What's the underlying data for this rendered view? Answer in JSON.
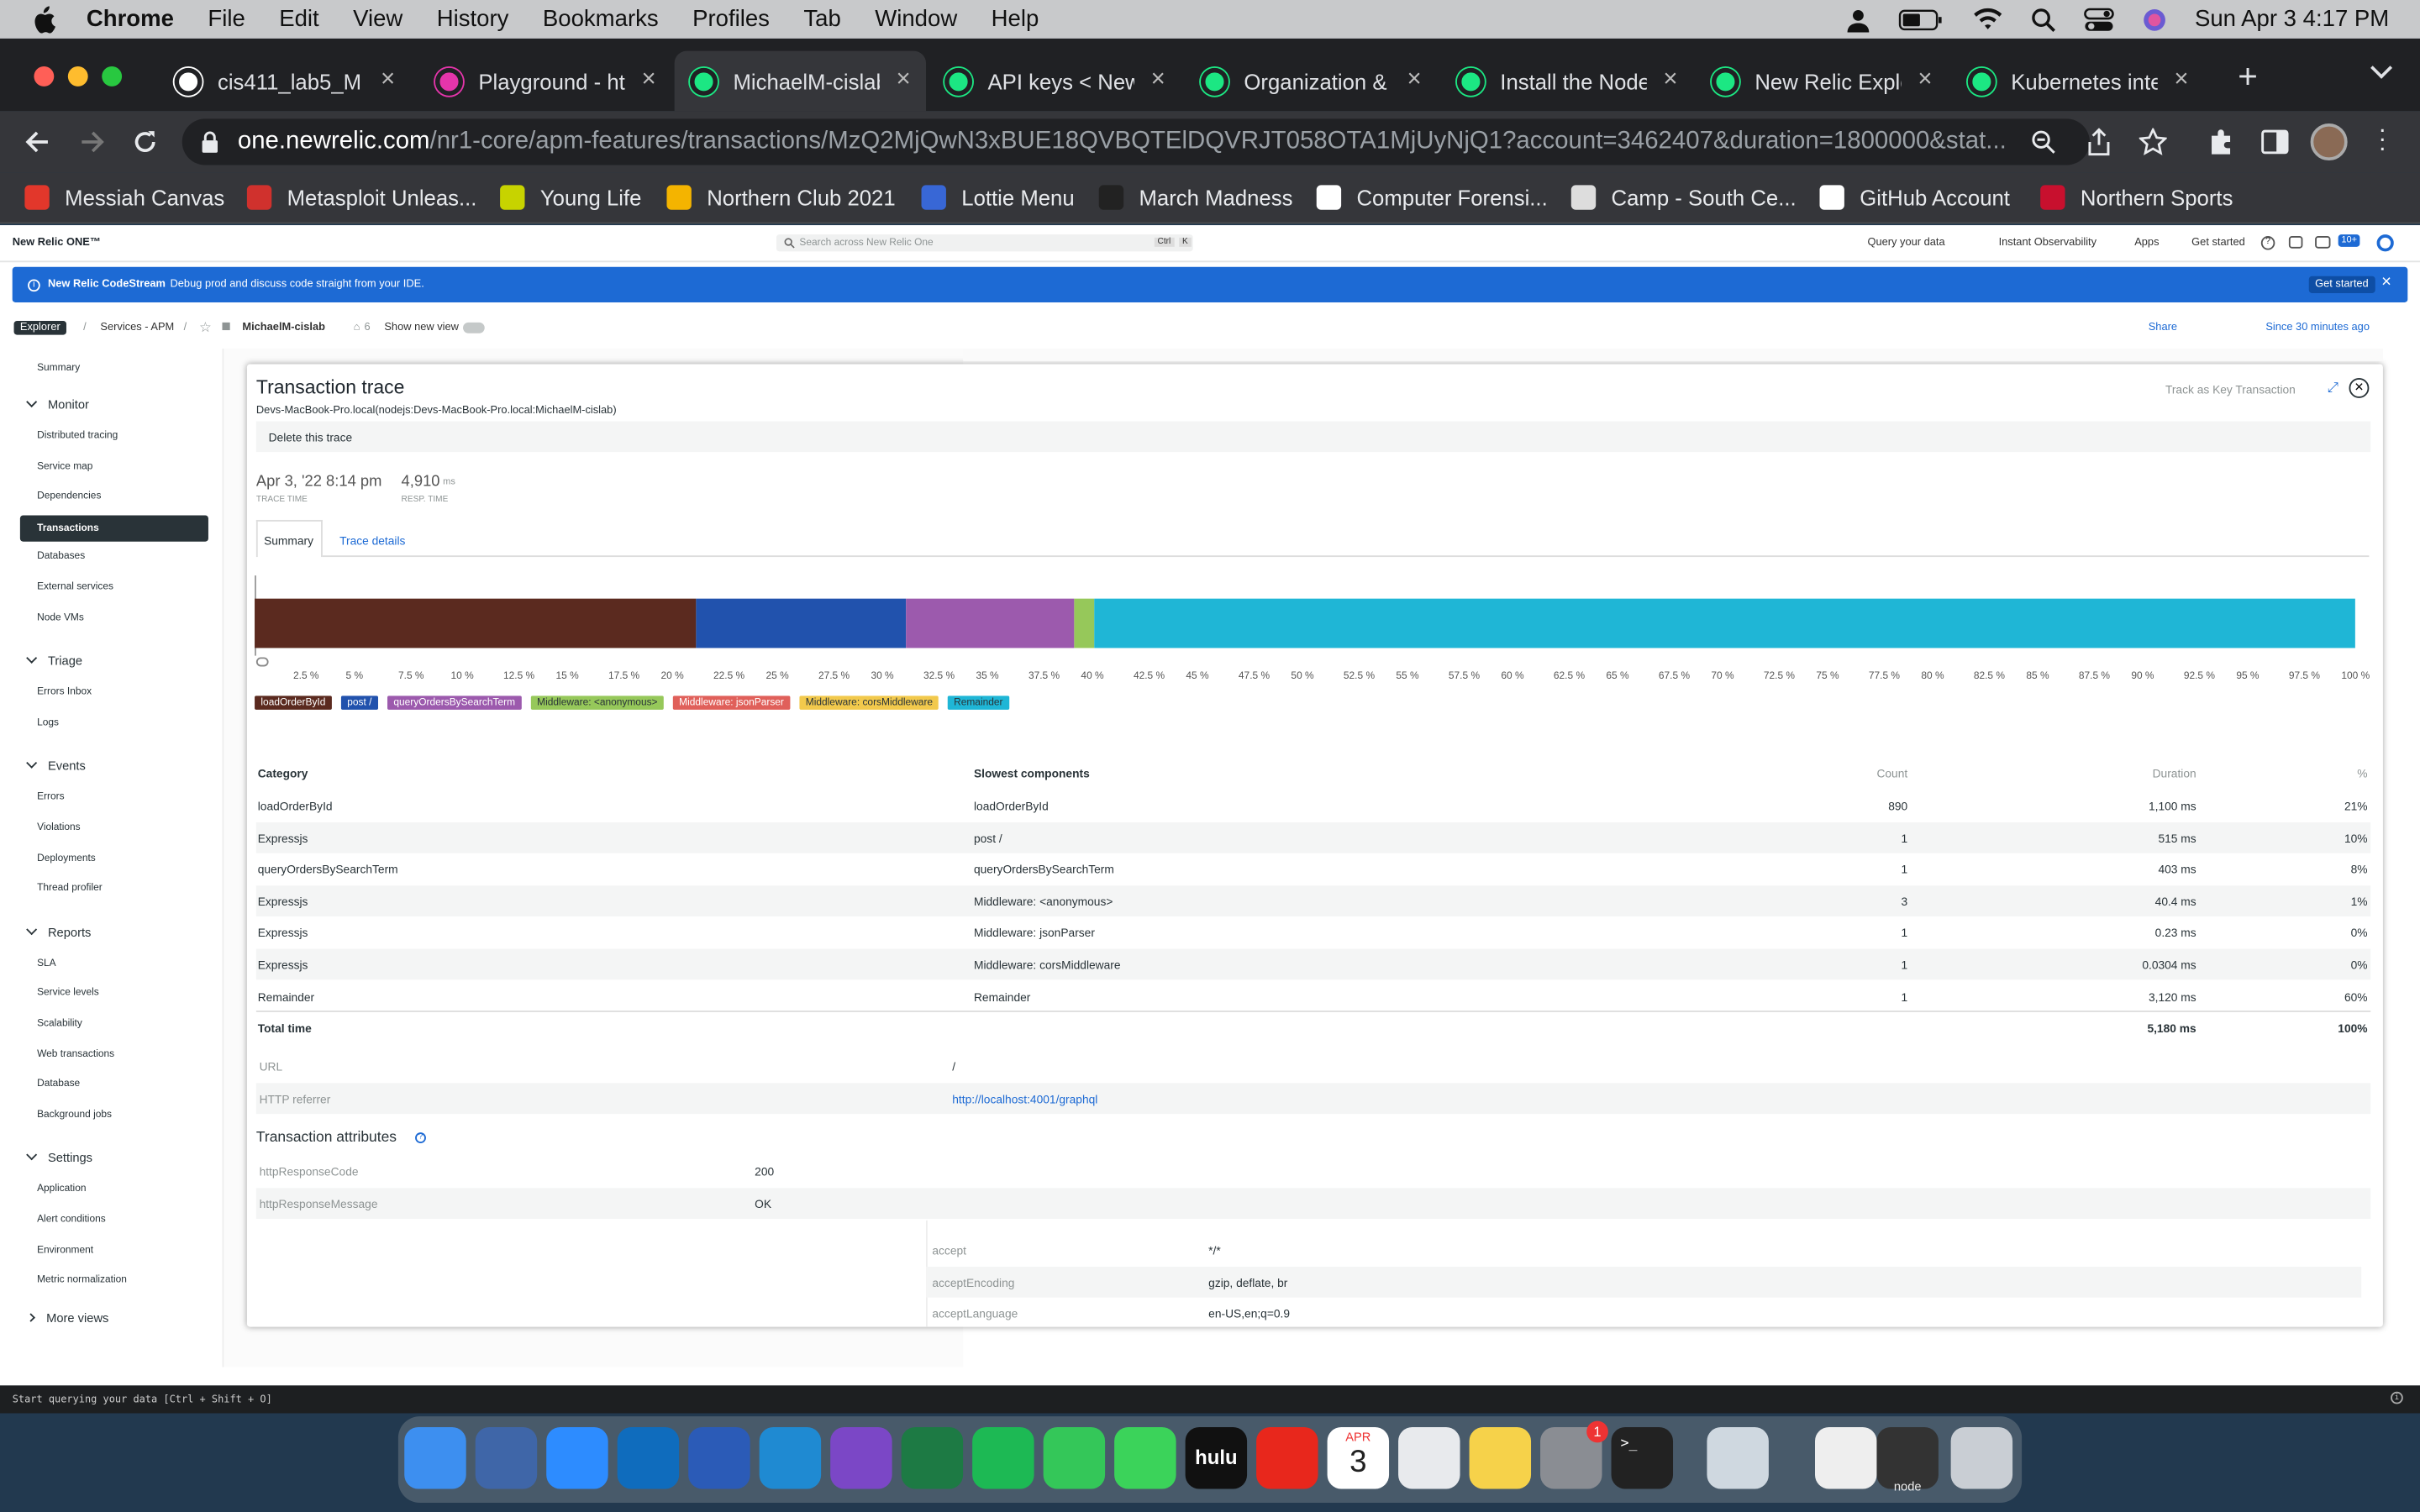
{
  "menubar": {
    "app": "Chrome",
    "items": [
      "File",
      "Edit",
      "View",
      "History",
      "Bookmarks",
      "Profiles",
      "Tab",
      "Window",
      "Help"
    ],
    "clock": "Sun Apr 3  4:17 PM"
  },
  "tabs": [
    {
      "label": "cis411_lab5_M",
      "color": "#ffffff"
    },
    {
      "label": "Playground - ht",
      "color": "#e535ab"
    },
    {
      "label": "MichaelM-cislab",
      "color": "#1ce783"
    },
    {
      "label": "API keys < New",
      "color": "#1ce783"
    },
    {
      "label": "Organization &",
      "color": "#1ce783"
    },
    {
      "label": "Install the Node",
      "color": "#1ce783"
    },
    {
      "label": "New Relic Explo",
      "color": "#1ce783"
    },
    {
      "label": "Kubernetes inte",
      "color": "#1ce783"
    }
  ],
  "url": {
    "host": "one.newrelic.com",
    "path": "/nr1-core/apm-features/transactions/MzQ2MjQwN3xBUE18QVBQTElDQVRJT058OTA1MjUyNjQ1?account=3462407&duration=1800000&stat..."
  },
  "bookmarks": [
    {
      "label": "Messiah Canvas",
      "color": "#e2372b"
    },
    {
      "label": "Metasploit Unleas...",
      "color": "#d0312d"
    },
    {
      "label": "Young Life",
      "color": "#c7d300"
    },
    {
      "label": "Northern Club 2021",
      "color": "#f4b400"
    },
    {
      "label": "Lottie Menu",
      "color": "#3867d6"
    },
    {
      "label": "March Madness",
      "color": "#222222"
    },
    {
      "label": "Computer Forensi...",
      "color": "#ffffff"
    },
    {
      "label": "Camp - South Ce...",
      "color": "#dddddd"
    },
    {
      "label": "GitHub Account",
      "color": "#ffffff"
    },
    {
      "label": "Northern Sports",
      "color": "#c8102e"
    }
  ],
  "nr": {
    "logo": "New Relic ONE™",
    "search_placeholder": "Search across New Relic One",
    "search_key1": "Ctrl",
    "search_key2": "K",
    "top_links": [
      "Query your data",
      "Instant Observability",
      "Apps",
      "Get started"
    ],
    "badge": "10+",
    "banner_title": "New Relic CodeStream",
    "banner_text": "Debug prod and discuss code straight from your IDE.",
    "banner_button": "Get started",
    "crumb": {
      "explorer": "Explorer",
      "services": "Services - APM",
      "entity": "MichaelM-cislab",
      "tags": "6",
      "new_view": "Show new view",
      "share": "Share",
      "time": "Since 30 minutes ago"
    }
  },
  "sidebar": {
    "top": "Summary",
    "sections": [
      {
        "title": "Monitor",
        "items": [
          "Distributed tracing",
          "Service map",
          "Dependencies",
          "Transactions",
          "Databases",
          "External services",
          "Node VMs"
        ]
      },
      {
        "title": "Triage",
        "items": [
          "Errors Inbox",
          "Logs"
        ]
      },
      {
        "title": "Events",
        "items": [
          "Errors",
          "Violations",
          "Deployments",
          "Thread profiler"
        ]
      },
      {
        "title": "Reports",
        "items": [
          "SLA",
          "Service levels",
          "Scalability",
          "Web transactions",
          "Database",
          "Background jobs"
        ]
      },
      {
        "title": "Settings",
        "items": [
          "Application",
          "Alert conditions",
          "Environment",
          "Metric normalization"
        ]
      }
    ],
    "more": "More views",
    "selected": "Transactions"
  },
  "trace": {
    "title": "Transaction trace",
    "host": "Devs-MacBook-Pro.local(nodejs:Devs-MacBook-Pro.local:MichaelM-cislab)",
    "key_tx": "Track as Key Transaction",
    "delete": "Delete this trace",
    "trace_time": "Apr 3, '22 8:14 pm",
    "trace_time_label": "TRACE TIME",
    "resp_time": "4,910",
    "resp_unit": "ms",
    "resp_label": "RESP. TIME",
    "tab_summary": "Summary",
    "tab_details": "Trace details"
  },
  "chart_data": {
    "type": "bar",
    "orientation": "horizontal-stacked",
    "xlim": [
      0,
      100
    ],
    "ticks": [
      "2.5 %",
      "5 %",
      "7.5 %",
      "10 %",
      "12.5 %",
      "15 %",
      "17.5 %",
      "20 %",
      "22.5 %",
      "25 %",
      "27.5 %",
      "30 %",
      "32.5 %",
      "35 %",
      "37.5 %",
      "40 %",
      "42.5 %",
      "45 %",
      "47.5 %",
      "50 %",
      "52.5 %",
      "55 %",
      "57.5 %",
      "60 %",
      "62.5 %",
      "65 %",
      "67.5 %",
      "70 %",
      "72.5 %",
      "75 %",
      "77.5 %",
      "80 %",
      "82.5 %",
      "85 %",
      "87.5 %",
      "90 %",
      "92.5 %",
      "95 %",
      "97.5 %",
      "100 %"
    ],
    "segments": [
      {
        "name": "loadOrderById",
        "value": 21,
        "color": "#5b2a1f"
      },
      {
        "name": "post /",
        "value": 10,
        "color": "#2152ad"
      },
      {
        "name": "queryOrdersBySearchTerm",
        "value": 8,
        "color": "#9c5aad"
      },
      {
        "name": "Middleware: <anonymous>",
        "value": 1,
        "color": "#96c85a"
      },
      {
        "name": "Middleware: jsonParser",
        "value": 0,
        "color": "#e0605a"
      },
      {
        "name": "Middleware: corsMiddleware",
        "value": 0,
        "color": "#f2c94c"
      },
      {
        "name": "Remainder",
        "value": 60,
        "color": "#1fb6d6"
      }
    ],
    "legend": [
      {
        "label": "loadOrderById",
        "color": "#5b2a1f",
        "text": "#ffffff"
      },
      {
        "label": "post /",
        "color": "#2152ad",
        "text": "#ffffff"
      },
      {
        "label": "queryOrdersBySearchTerm",
        "color": "#9c5aad",
        "text": "#ffffff"
      },
      {
        "label": "Middleware: <anonymous>",
        "color": "#96c85a",
        "text": "#293338"
      },
      {
        "label": "Middleware: jsonParser",
        "color": "#e0605a",
        "text": "#ffffff"
      },
      {
        "label": "Middleware: corsMiddleware",
        "color": "#f2c94c",
        "text": "#293338"
      },
      {
        "label": "Remainder",
        "color": "#1fb6d6",
        "text": "#293338"
      }
    ]
  },
  "table": {
    "headers": [
      "Category",
      "Slowest components",
      "Count",
      "Duration",
      "%"
    ],
    "rows": [
      [
        "loadOrderById",
        "loadOrderById",
        "890",
        "1,100 ms",
        "21%"
      ],
      [
        "Expressjs",
        "post /",
        "1",
        "515 ms",
        "10%"
      ],
      [
        "queryOrdersBySearchTerm",
        "queryOrdersBySearchTerm",
        "1",
        "403 ms",
        "8%"
      ],
      [
        "Expressjs",
        "Middleware: <anonymous>",
        "3",
        "40.4 ms",
        "1%"
      ],
      [
        "Expressjs",
        "Middleware: jsonParser",
        "1",
        "0.23 ms",
        "0%"
      ],
      [
        "Expressjs",
        "Middleware: corsMiddleware",
        "1",
        "0.0304 ms",
        "0%"
      ],
      [
        "Remainder",
        "Remainder",
        "1",
        "3,120 ms",
        "60%"
      ]
    ],
    "total": [
      "Total time",
      "5,180 ms",
      "100%"
    ]
  },
  "request": {
    "url_label": "URL",
    "url_value": "/",
    "referrer_label": "HTTP referrer",
    "referrer_value": "http://localhost:4001/graphql"
  },
  "attributes": {
    "title": "Transaction attributes",
    "rows": [
      [
        "httpResponseCode",
        "200"
      ],
      [
        "httpResponseMessage",
        "OK"
      ]
    ],
    "headers": [
      [
        "accept",
        "*/*"
      ],
      [
        "acceptEncoding",
        "gzip, deflate, br"
      ],
      [
        "acceptLanguage",
        "en-US,en;q=0.9"
      ]
    ]
  },
  "statusbar": "Start querying your data [Ctrl + Shift + O]",
  "dock": [
    {
      "name": "finder-icon",
      "color": "#3d8ff0"
    },
    {
      "name": "virtualbox-icon",
      "color": "#3f66a8"
    },
    {
      "name": "zoom-icon",
      "color": "#2d8cff"
    },
    {
      "name": "outlook-icon",
      "color": "#0f6cbd"
    },
    {
      "name": "word-icon",
      "color": "#2b5bb7"
    },
    {
      "name": "vscode-icon",
      "color": "#1f8ad2"
    },
    {
      "name": "github-desktop-icon",
      "color": "#7b47c6"
    },
    {
      "name": "excel-icon",
      "color": "#1d7a44"
    },
    {
      "name": "spotify-icon",
      "color": "#1db954"
    },
    {
      "name": "facetime-icon",
      "color": "#34c759"
    },
    {
      "name": "messages-icon",
      "color": "#3bd35a"
    },
    {
      "name": "hulu-icon",
      "color": "#111111"
    },
    {
      "name": "acrobat-icon",
      "color": "#e8271c"
    },
    {
      "name": "calendar-icon",
      "color": "#ffffff"
    },
    {
      "name": "chrome-icon",
      "color": "#e8eaed"
    },
    {
      "name": "notes-icon",
      "color": "#f6d24a"
    },
    {
      "name": "system-preferences-icon",
      "color": "#8a8d93"
    },
    {
      "name": "terminal-icon",
      "color": "#222222"
    },
    {
      "name": "preview-icon",
      "color": "#cfd8e0"
    },
    {
      "name": "document-icon",
      "color": "#eeeeee"
    },
    {
      "name": "node-window-icon",
      "color": "#333333"
    },
    {
      "name": "trash-icon",
      "color": "#c9ced4"
    }
  ],
  "dock_labels": {
    "calendar_month": "APR",
    "calendar_day": "3",
    "prefs_badge": "1",
    "node": "node"
  }
}
